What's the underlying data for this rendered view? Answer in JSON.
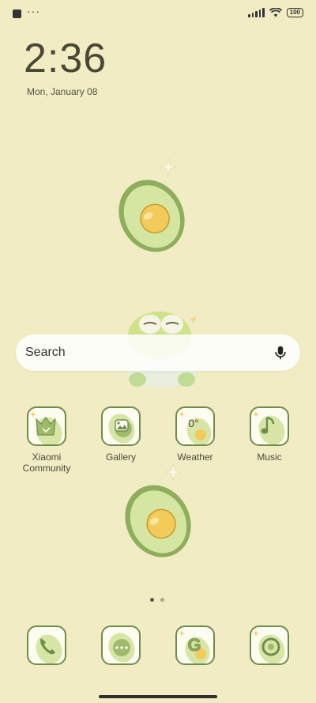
{
  "status_bar": {
    "dots": "···",
    "battery": "100"
  },
  "lockscreen": {
    "time": "2:36",
    "date": "Mon, January 08"
  },
  "search": {
    "placeholder": "Search"
  },
  "apps": [
    {
      "label": "Xiaomi\nCommunity",
      "icon": "xiaomi-community-icon"
    },
    {
      "label": "Gallery",
      "icon": "gallery-icon"
    },
    {
      "label": "Weather",
      "icon": "weather-icon",
      "icon_text": "0°"
    },
    {
      "label": "Music",
      "icon": "music-icon"
    }
  ],
  "dock": [
    {
      "icon": "phone-icon"
    },
    {
      "icon": "messages-icon"
    },
    {
      "icon": "google-icon",
      "icon_text": "G"
    },
    {
      "icon": "browser-icon"
    }
  ],
  "colors": {
    "background": "#f1ecc4",
    "accent_green": "#6f8d4a",
    "avocado_light": "#d7e6a6",
    "seed": "#f2cb5a"
  }
}
